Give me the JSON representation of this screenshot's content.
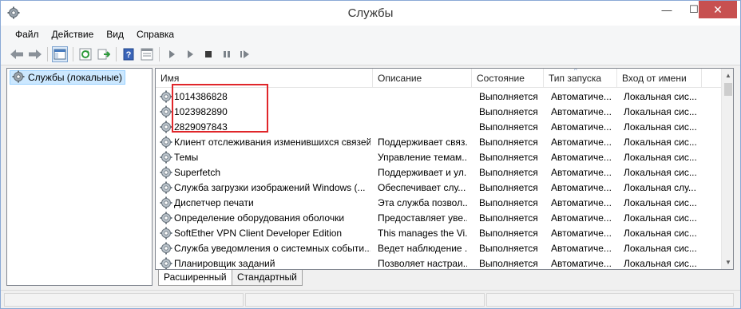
{
  "window": {
    "title": "Службы",
    "controls": {
      "minimize": "—",
      "maximize": "☐",
      "close": "✕"
    }
  },
  "menu": [
    "Файл",
    "Действие",
    "Вид",
    "Справка"
  ],
  "toolbar": {
    "icons": [
      "back-icon",
      "forward-icon",
      "console-tree-icon",
      "refresh-icon",
      "export-list-icon",
      "help-icon",
      "properties-icon",
      "start-service-icon",
      "start-service-params-icon",
      "stop-service-icon",
      "pause-service-icon",
      "restart-service-icon"
    ]
  },
  "tree": {
    "root_label": "Службы (локальные)"
  },
  "columns": [
    "Имя",
    "Описание",
    "Состояние",
    "Тип запуска",
    "Вход от имени"
  ],
  "services": [
    {
      "name": "1014386828",
      "desc": "",
      "state": "Выполняется",
      "startup": "Автоматичe...",
      "logon": "Локальная сис..."
    },
    {
      "name": "1023982890",
      "desc": "",
      "state": "Выполняется",
      "startup": "Автоматичe...",
      "logon": "Локальная сис..."
    },
    {
      "name": "2829097843",
      "desc": "",
      "state": "Выполняется",
      "startup": "Автоматичe...",
      "logon": "Локальная сис..."
    },
    {
      "name": "Клиент отслеживания изменившихся связей",
      "desc": "Поддерживает связ...",
      "state": "Выполняется",
      "startup": "Автоматичe...",
      "logon": "Локальная сис..."
    },
    {
      "name": "Темы",
      "desc": "Управление темам...",
      "state": "Выполняется",
      "startup": "Автоматичe...",
      "logon": "Локальная сис..."
    },
    {
      "name": "Superfetch",
      "desc": "Поддерживает и ул...",
      "state": "Выполняется",
      "startup": "Автоматичe...",
      "logon": "Локальная сис..."
    },
    {
      "name": "Служба загрузки изображений Windows (...",
      "desc": "Обеспечивает слу...",
      "state": "Выполняется",
      "startup": "Автоматичe...",
      "logon": "Локальная слу..."
    },
    {
      "name": "Диспетчер печати",
      "desc": "Эта служба позвол...",
      "state": "Выполняется",
      "startup": "Автоматичe...",
      "logon": "Локальная сис..."
    },
    {
      "name": "Определение оборудования оболочки",
      "desc": "Предоставляет уве...",
      "state": "Выполняется",
      "startup": "Автоматичe...",
      "logon": "Локальная сис..."
    },
    {
      "name": "SoftEther VPN Client Developer Edition",
      "desc": "This manages the Vi...",
      "state": "Выполняется",
      "startup": "Автоматичe...",
      "logon": "Локальная сис..."
    },
    {
      "name": "Служба уведомления о системных событи...",
      "desc": "Ведет наблюдение ...",
      "state": "Выполняется",
      "startup": "Автоматичe...",
      "logon": "Локальная сис..."
    },
    {
      "name": "Планировщик заданий",
      "desc": "Позволяет настраи...",
      "state": "Выполняется",
      "startup": "Автоматичe...",
      "logon": "Локальная сис..."
    }
  ],
  "tabs": [
    "Расширенный",
    "Стандартный"
  ],
  "colors": {
    "highlight": "#e0262a",
    "selection": "#cce8ff",
    "close_button": "#c75050"
  }
}
